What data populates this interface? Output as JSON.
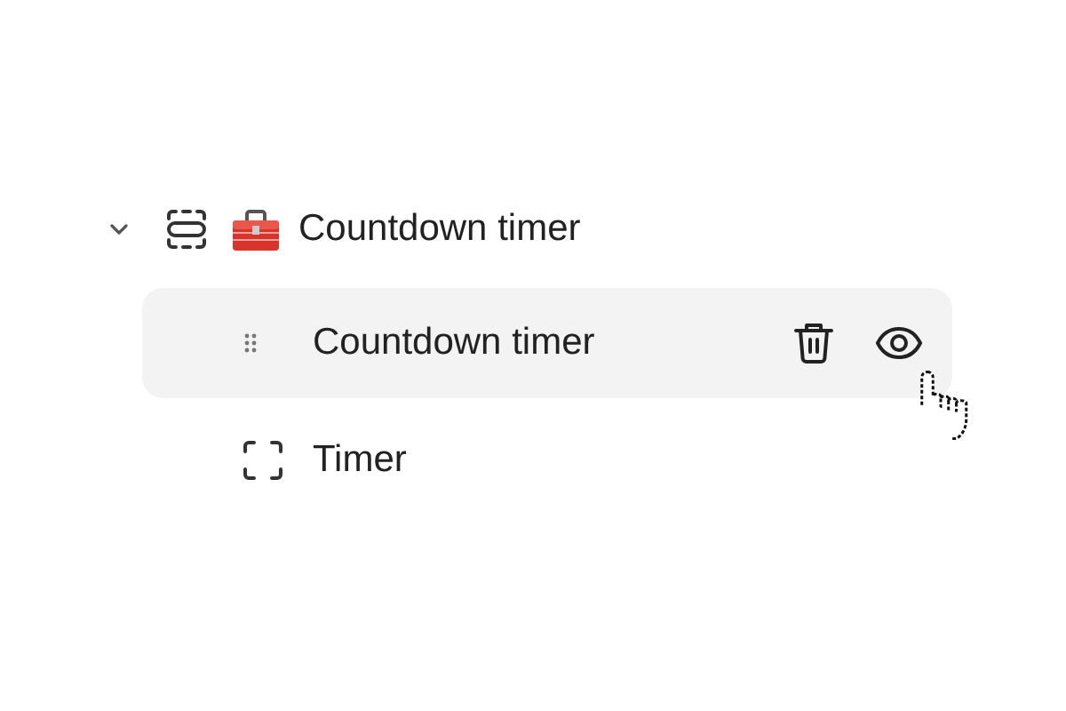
{
  "tree": [
    {
      "label": "Countdown timer",
      "expanded": true,
      "children": [
        {
          "label": "Countdown timer",
          "hovered": true
        },
        {
          "label": "Timer",
          "hovered": false
        }
      ]
    }
  ]
}
